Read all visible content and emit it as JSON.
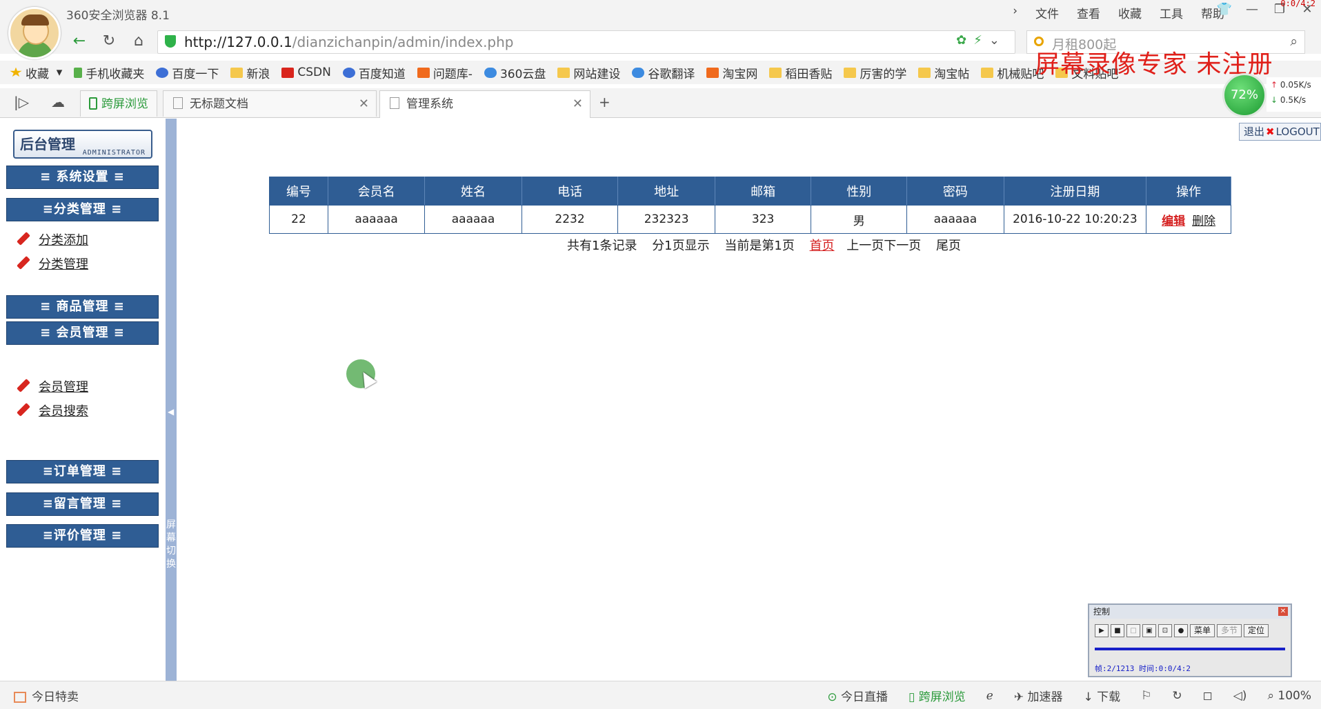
{
  "browser": {
    "app_title": "360安全浏览器 8.1",
    "menu": [
      "文件",
      "查看",
      "收藏",
      "工具",
      "帮助"
    ],
    "record_timer": "0:0/4:2",
    "url_host": "http://127.0.0.1",
    "url_path": "/dianzichanpin/admin/index.php",
    "search_placeholder": "月租800起",
    "watermark": "屏幕录像专家  未注册",
    "bookmarks": [
      "收藏",
      "手机收藏夹",
      "百度一下",
      "新浪",
      "CSDN",
      "百度知道",
      "问题库-",
      "360云盘",
      "网站建设",
      "谷歌翻译",
      "淘宝网",
      "稻田香贴",
      "厉害的学",
      "淘宝帖",
      "机械贴吧",
      "文料贴吧"
    ],
    "tabs": [
      {
        "label": "跨屏浏览"
      },
      {
        "label": "无标题文档"
      },
      {
        "label": "管理系统"
      }
    ],
    "net": {
      "percent": "72%",
      "upload": "0.05K/s",
      "download": "0.5K/s"
    }
  },
  "sidebar": {
    "logo_main": "后台管理",
    "logo_sub": "ADMINISTRATOR",
    "sections": [
      {
        "label": "≡  系统设置 ≡"
      },
      {
        "label": "≡分类管理  ≡"
      },
      {
        "label": "≡  商品管理  ≡"
      },
      {
        "label": "≡  会员管理  ≡"
      },
      {
        "label": "≡订单管理  ≡"
      },
      {
        "label": "≡留言管理  ≡"
      },
      {
        "label": "≡评价管理  ≡"
      }
    ],
    "links": [
      "分类添加",
      "分类管理",
      "会员管理",
      "会员搜索"
    ],
    "splitter_text": "屏幕切换"
  },
  "main": {
    "logout_cn": "退出",
    "logout_en": "LOGOUT",
    "table": {
      "headers": [
        "编号",
        "会员名",
        "姓名",
        "电话",
        "地址",
        "邮箱",
        "性别",
        "密码",
        "注册日期",
        "操作"
      ],
      "rows": [
        [
          "22",
          "aaaaaa",
          "aaaaaa",
          "2232",
          "232323",
          "323",
          "男",
          "aaaaaa",
          "2016-10-22 10:20:23"
        ]
      ],
      "edit_label": "编辑",
      "delete_label": "删除"
    },
    "pager": {
      "total": "共有1条记录",
      "pages": "分1页显示",
      "current": "当前是第1页",
      "first": "首页",
      "prev_next": "上一页下一页",
      "last": "尾页"
    }
  },
  "recorder": {
    "title": "控制",
    "btn_menu": "菜单",
    "btn_multi": "多节",
    "btn_locate": "定位",
    "status": "帧:2/1213 时间:0:0/4:2"
  },
  "statusbar": {
    "left": "今日特卖",
    "items": [
      "今日直播",
      "跨屏浏览",
      "加速器",
      "下载",
      "100%"
    ]
  }
}
